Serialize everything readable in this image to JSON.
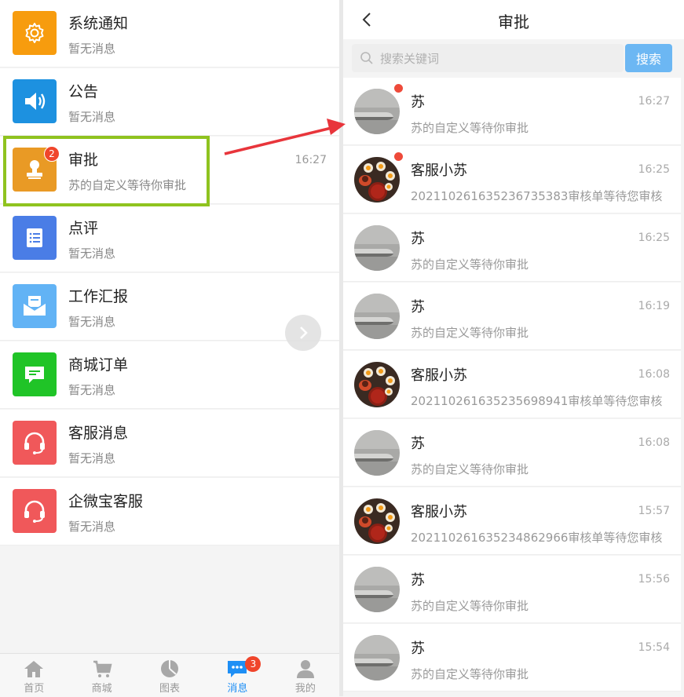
{
  "left": {
    "messages": [
      {
        "title": "系统通知",
        "sub": "暂无消息",
        "time": "",
        "icon": "gear-icon",
        "color": "#f79c0e"
      },
      {
        "title": "公告",
        "sub": "暂无消息",
        "time": "",
        "icon": "speaker-icon",
        "color": "#1d91e0"
      },
      {
        "title": "审批",
        "sub": "苏的自定义等待你审批",
        "time": "16:27",
        "icon": "stamp-icon",
        "color": "#e99a25",
        "badge": "2"
      },
      {
        "title": "点评",
        "sub": "暂无消息",
        "time": "",
        "icon": "list-icon",
        "color": "#4a7de6"
      },
      {
        "title": "工作汇报",
        "sub": "暂无消息",
        "time": "",
        "icon": "envelope-icon",
        "color": "#62b3f5"
      },
      {
        "title": "商城订单",
        "sub": "暂无消息",
        "time": "",
        "icon": "chat-icon",
        "color": "#20c427"
      },
      {
        "title": "客服消息",
        "sub": "暂无消息",
        "time": "",
        "icon": "headset-icon",
        "color": "#f0585a"
      },
      {
        "title": "企微宝客服",
        "sub": "暂无消息",
        "time": "",
        "icon": "headset-icon",
        "color": "#f0585a"
      }
    ],
    "tabs": [
      {
        "label": "首页",
        "icon": "home-icon"
      },
      {
        "label": "商城",
        "icon": "cart-icon"
      },
      {
        "label": "图表",
        "icon": "pie-chart-icon"
      },
      {
        "label": "消息",
        "icon": "message-icon",
        "badge": "3",
        "active": true
      },
      {
        "label": "我的",
        "icon": "person-icon"
      }
    ]
  },
  "right": {
    "title": "审批",
    "search": {
      "placeholder": "搜索关键词",
      "value": "",
      "button": "搜索"
    },
    "items": [
      {
        "name": "苏",
        "sub": "苏的自定义等待你审批",
        "time": "16:27",
        "avatar": "door-handle",
        "unread": true
      },
      {
        "name": "客服小苏",
        "sub": "20211026163523673538​3审核单等待您审核",
        "time": "16:25",
        "avatar": "food",
        "unread": true
      },
      {
        "name": "苏",
        "sub": "苏的自定义等待你审批",
        "time": "16:25",
        "avatar": "door-handle",
        "unread": false
      },
      {
        "name": "苏",
        "sub": "苏的自定义等待你审批",
        "time": "16:19",
        "avatar": "door-handle",
        "unread": false
      },
      {
        "name": "客服小苏",
        "sub": "20211026163523569894​1审核单等待您审核",
        "time": "16:08",
        "avatar": "food",
        "unread": false
      },
      {
        "name": "苏",
        "sub": "苏的自定义等待你审批",
        "time": "16:08",
        "avatar": "door-handle",
        "unread": false
      },
      {
        "name": "客服小苏",
        "sub": "20211026163523486296​6审核单等待您审核",
        "time": "15:57",
        "avatar": "food",
        "unread": false
      },
      {
        "name": "苏",
        "sub": "苏的自定义等待你审批",
        "time": "15:56",
        "avatar": "door-handle",
        "unread": false
      },
      {
        "name": "苏",
        "sub": "苏的自定义等待你审批",
        "time": "15:54",
        "avatar": "door-handle",
        "unread": false
      }
    ]
  },
  "colors": {
    "highlight": "#8fc31f",
    "arrow": "#e8353b",
    "accent": "#1e8ff5",
    "badge": "#f0452b"
  }
}
